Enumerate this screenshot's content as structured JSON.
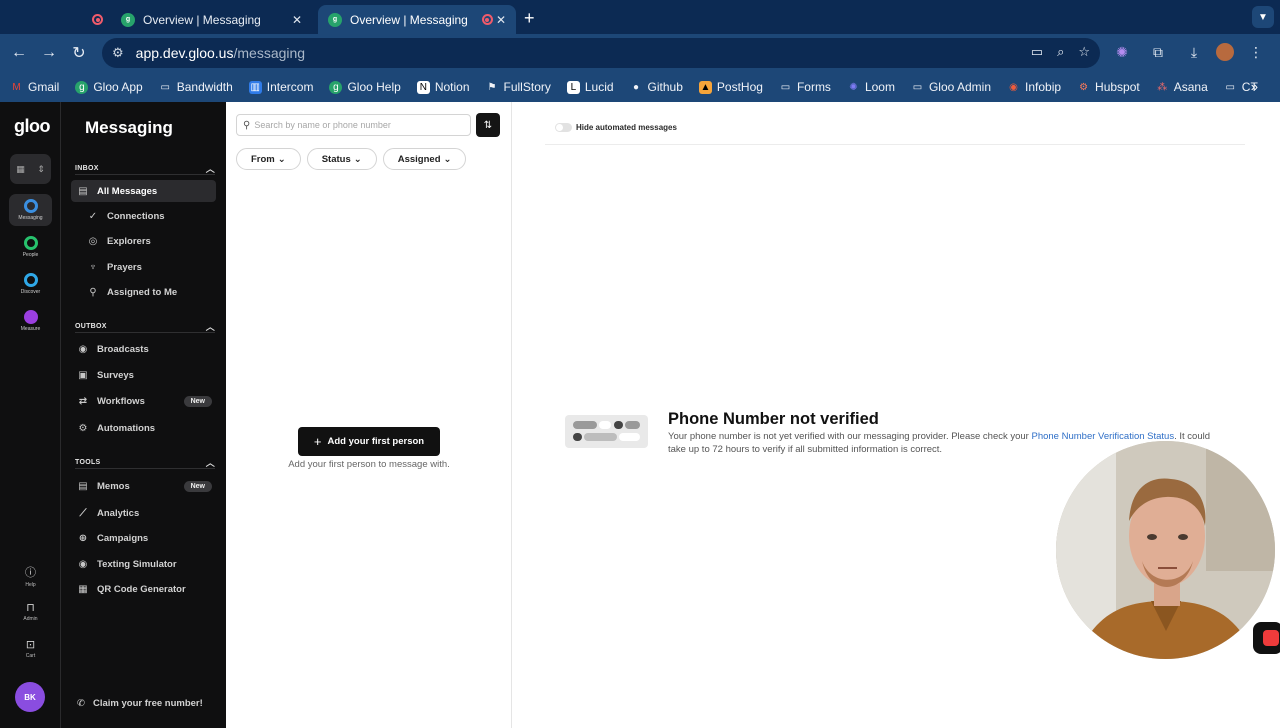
{
  "browser": {
    "tabs": [
      {
        "title": "Overview | Messaging",
        "active": false
      },
      {
        "title": "Overview | Messaging",
        "active": true
      }
    ],
    "url_host": "app.dev.gloo.us",
    "url_path": "/messaging",
    "bookmarks": [
      "Gmail",
      "Gloo App",
      "Bandwidth",
      "Intercom",
      "Gloo Help",
      "Notion",
      "FullStory",
      "Lucid",
      "Github",
      "PostHog",
      "Forms",
      "Loom",
      "Gloo Admin",
      "Infobip",
      "Hubspot",
      "Asana",
      "CT"
    ]
  },
  "rail": {
    "logo": "gloo",
    "items": [
      {
        "label": "Messaging",
        "color": "#3b8fe0"
      },
      {
        "label": "People",
        "color": "#27c26d"
      },
      {
        "label": "Discover",
        "color": "#2fa8e8"
      },
      {
        "label": "Measure",
        "color": "#9b3fe0"
      }
    ],
    "bottom": [
      {
        "label": "Help"
      },
      {
        "label": "Admin"
      },
      {
        "label": "Cart"
      }
    ],
    "avatar_initials": "BK"
  },
  "sidebar": {
    "title": "Messaging",
    "sections": {
      "inbox": "INBOX",
      "outbox": "OUTBOX",
      "tools": "TOOLS"
    },
    "inbox_items": [
      "All Messages",
      "Connections",
      "Explorers",
      "Prayers",
      "Assigned to Me"
    ],
    "outbox_items": [
      "Broadcasts",
      "Surveys",
      "Workflows",
      "Automations"
    ],
    "tools_items": [
      "Memos",
      "Analytics",
      "Campaigns",
      "Texting Simulator",
      "QR Code Generator"
    ],
    "new_badge": "New",
    "claim": "Claim your free number!"
  },
  "list": {
    "search_placeholder": "Search by name or phone number",
    "filters": [
      "From",
      "Status",
      "Assigned"
    ],
    "add_button": "Add your first person",
    "add_hint": "Add your first person to message with."
  },
  "detail": {
    "toggle_label": "Hide automated messages",
    "title": "Phone Number not verified",
    "text_before": "Your phone number is not yet verified with our messaging provider. Please check your ",
    "link": "Phone Number Verification Status",
    "text_after": ". It could take up to 72 hours to verify if all submitted information is correct."
  }
}
